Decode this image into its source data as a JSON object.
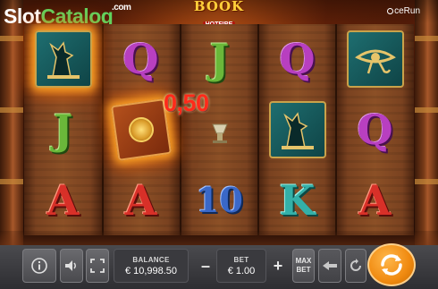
{
  "watermark": {
    "slot": "Slot",
    "catalog": "Catalog",
    "com": ".com"
  },
  "game": {
    "title_line1": "BOOK",
    "title_line2": "HOTFIRE"
  },
  "provider": {
    "name": "ceRun"
  },
  "reels": [
    [
      "anubis",
      "J",
      "A"
    ],
    [
      "Q",
      "book",
      "A"
    ],
    [
      "J",
      "lamp",
      "10"
    ],
    [
      "Q",
      "anubis",
      "K"
    ],
    [
      "eye-of-horus",
      "Q",
      "A"
    ]
  ],
  "win": {
    "amount": "0,50"
  },
  "controls": {
    "balance_label": "BALANCE",
    "balance_value": "€ 10,998.50",
    "bet_label": "BET",
    "bet_value": "€ 1.00",
    "minus": "–",
    "plus": "+",
    "max_bet_line1": "MAX",
    "max_bet_line2": "BET"
  },
  "colors": {
    "spin_button": "#f08a10",
    "win_text": "#ff2a1a",
    "control_bar": "#3a3a3e"
  }
}
